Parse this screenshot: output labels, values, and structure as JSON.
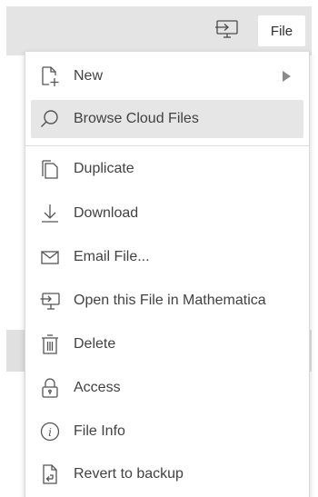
{
  "toolbar": {
    "open_desktop_icon": "monitor-arrow-icon",
    "file_label": "File"
  },
  "menu": {
    "items": [
      {
        "label": "New",
        "icon": "new-file-icon",
        "has_submenu": true
      },
      {
        "label": "Browse Cloud Files",
        "icon": "search-icon",
        "highlighted": true
      },
      {
        "label": "Duplicate",
        "icon": "duplicate-icon"
      },
      {
        "label": "Download",
        "icon": "download-icon"
      },
      {
        "label": "Email File...",
        "icon": "envelope-icon"
      },
      {
        "label": "Open this File in Mathematica",
        "icon": "monitor-arrow-icon"
      },
      {
        "label": "Delete",
        "icon": "trash-icon"
      },
      {
        "label": "Access",
        "icon": "lock-icon"
      },
      {
        "label": "File Info",
        "icon": "info-icon"
      },
      {
        "label": "Revert to backup",
        "icon": "revert-icon"
      }
    ]
  },
  "colors": {
    "toolbar_bg": "#e4e4e4",
    "highlight_bg": "#e6e6e6",
    "icon_stroke": "#555555",
    "text": "#424242"
  }
}
